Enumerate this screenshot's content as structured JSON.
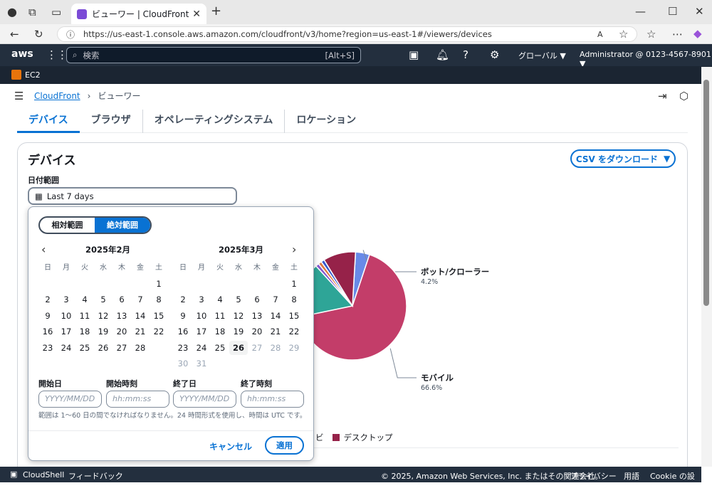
{
  "browser": {
    "tab_title": "ビューワー | CloudFront | Global",
    "url": "https://us-east-1.console.aws.amazon.com/cloudfront/v3/home?region=us-east-1#/viewers/devices"
  },
  "aws_bar": {
    "logo": "aws",
    "search_placeholder": "検索",
    "search_shortcut": "[Alt+S]",
    "region": "グローバル ▼",
    "account": "Administrator @ 0123-4567-8901 ▼",
    "service_tag": "EC2"
  },
  "breadcrumb": {
    "root": "CloudFront",
    "current": "ビューワー"
  },
  "tabs": [
    {
      "label": "デバイス",
      "active": true
    },
    {
      "label": "ブラウザ",
      "active": false
    },
    {
      "label": "オペレーティングシステム",
      "active": false
    },
    {
      "label": "ロケーション",
      "active": false
    }
  ],
  "card": {
    "title": "デバイス",
    "download_label": "CSV をダウンロード",
    "date_range_label": "日付範囲",
    "date_range_value": "Last 7 days"
  },
  "picker": {
    "relative_label": "相対範囲",
    "absolute_label": "絶対範囲",
    "weekdays": [
      "日",
      "月",
      "火",
      "水",
      "木",
      "金",
      "土"
    ],
    "month_left": "2025年2月",
    "month_right": "2025年3月",
    "start_date_label": "開始日",
    "start_time_label": "開始時刻",
    "end_date_label": "終了日",
    "end_time_label": "終了時刻",
    "date_placeholder": "YYYY/MM/DD",
    "time_placeholder": "hh:mm:ss",
    "hint": "範囲は 1〜60 日の間でなければなりません。24 時間形式を使用し、時間は UTC です。",
    "cancel_label": "キャンセル",
    "apply_label": "適用"
  },
  "chart_data": {
    "type": "pie",
    "slices": [
      {
        "name": "ボット/クローラー",
        "value": 4.2,
        "color": "#688ae8",
        "label": "4.2%"
      },
      {
        "name": "モバイル",
        "value": 66.6,
        "color": "#c33d69",
        "label": "66.6%"
      },
      {
        "name": "",
        "value": 16.5,
        "color": "#2ea597",
        "label": ""
      },
      {
        "name": "",
        "value": 1.0,
        "color": "#8456ce",
        "label": ""
      },
      {
        "name": "",
        "value": 1.0,
        "color": "#e07941",
        "label": ""
      },
      {
        "name": "",
        "value": 1.0,
        "color": "#3759ce",
        "label": ""
      },
      {
        "name": "デスクトップ",
        "value": 9.7,
        "color": "#962249",
        "label": ""
      }
    ],
    "legend_visible": [
      "ビ",
      "デスクトップ"
    ],
    "legend_placement": "bottom"
  },
  "footer": {
    "cloudshell": "CloudShell",
    "feedback": "フィードバック",
    "copyright": "© 2025, Amazon Web Services, Inc. またはその関連会社。",
    "privacy": "プライバシー",
    "terms": "用語",
    "cookie": "Cookie の設定"
  }
}
